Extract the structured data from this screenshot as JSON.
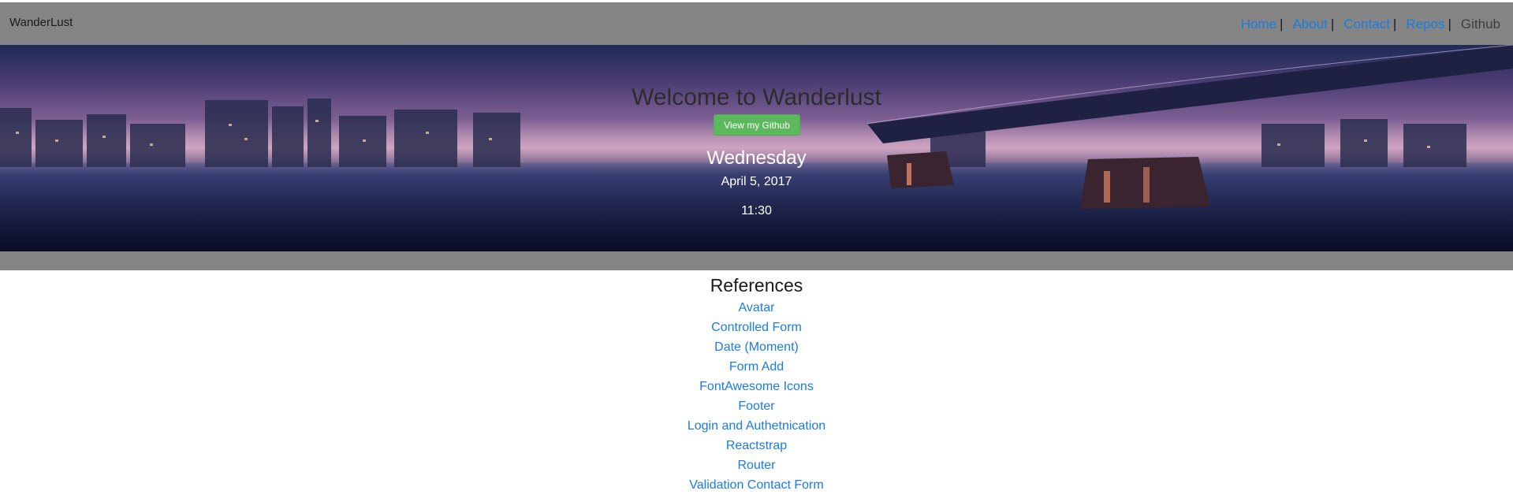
{
  "navbar": {
    "brand": "WanderLust",
    "links": [
      {
        "label": "Home"
      },
      {
        "label": "About"
      },
      {
        "label": "Contact"
      },
      {
        "label": "Repos"
      },
      {
        "label": "Github"
      }
    ],
    "separator": "|"
  },
  "hero": {
    "title": "Welcome to Wanderlust",
    "button_label": "View my Github",
    "day": "Wednesday",
    "date": "April 5, 2017",
    "time": "11:30"
  },
  "references": {
    "title": "References",
    "items": [
      "Avatar",
      "Controlled Form",
      "Date (Moment)",
      "Form Add",
      "FontAwesome Icons",
      "Footer",
      "Login and Authetnication",
      "Reactstrap",
      "Router",
      "Validation Contact Form"
    ]
  },
  "colors": {
    "link": "#1a7be0",
    "button": "#5cb85c",
    "band": "#858585"
  }
}
